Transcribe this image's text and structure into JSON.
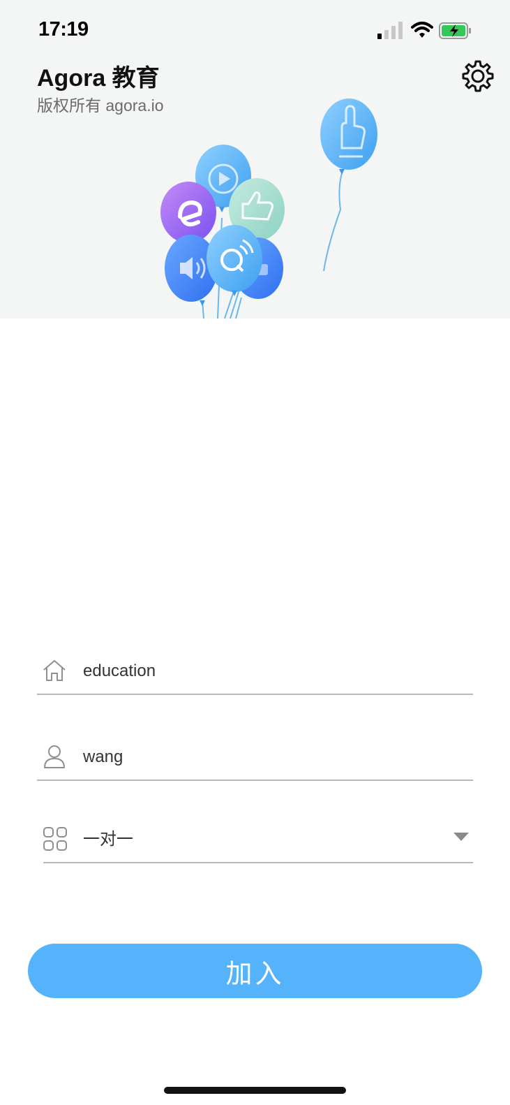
{
  "status_bar": {
    "time": "17:19",
    "icons": [
      "signal-icon",
      "wifi-icon",
      "battery-charging-icon"
    ]
  },
  "header": {
    "title": "Agora 教育",
    "subtitle": "版权所有 agora.io",
    "settings_icon": "gear-icon"
  },
  "hero_illustration": {
    "balloons": [
      "play-icon",
      "thumbs-up-icon",
      "edu-logo-icon",
      "speaker-icon",
      "chat-icon",
      "camera-icon",
      "hand-pointer-icon"
    ]
  },
  "form": {
    "room": {
      "icon": "home-icon",
      "value": "education"
    },
    "name": {
      "icon": "user-icon",
      "value": "wang"
    },
    "mode": {
      "icon": "grid-icon",
      "value": "一对一",
      "dropdown_icon": "caret-down-icon"
    }
  },
  "join_button": {
    "label": "加入",
    "color": "#54b3fb"
  },
  "colors": {
    "hero_bg": "#f4f6f6",
    "underline": "#b8b8b8"
  }
}
